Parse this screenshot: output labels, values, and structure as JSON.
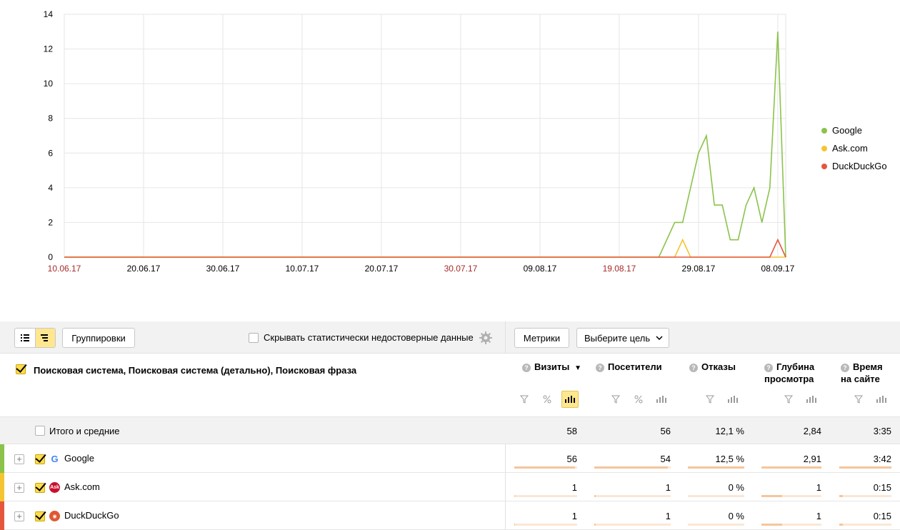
{
  "chart_data": {
    "type": "line",
    "y_ticks": [
      "0",
      "2",
      "4",
      "6",
      "8",
      "10",
      "12",
      "14"
    ],
    "ylim": [
      0,
      14
    ],
    "x_ticks": [
      {
        "label": "10.06.17",
        "weekend": true
      },
      {
        "label": "20.06.17",
        "weekend": false
      },
      {
        "label": "30.06.17",
        "weekend": false
      },
      {
        "label": "10.07.17",
        "weekend": false
      },
      {
        "label": "20.07.17",
        "weekend": false
      },
      {
        "label": "30.07.17",
        "weekend": true
      },
      {
        "label": "09.08.17",
        "weekend": false
      },
      {
        "label": "19.08.17",
        "weekend": true
      },
      {
        "label": "29.08.17",
        "weekend": false
      },
      {
        "label": "08.09.17",
        "weekend": false
      }
    ],
    "series": [
      {
        "name": "Google",
        "color": "#8bc34a",
        "points": [
          [
            "10.06.17",
            0
          ],
          [
            "24.08.17",
            0
          ],
          [
            "26.08.17",
            2
          ],
          [
            "27.08.17",
            2
          ],
          [
            "29.08.17",
            6
          ],
          [
            "30.08.17",
            7
          ],
          [
            "31.08.17",
            3
          ],
          [
            "01.09.17",
            3
          ],
          [
            "02.09.17",
            1
          ],
          [
            "03.09.17",
            1
          ],
          [
            "04.09.17",
            3
          ],
          [
            "05.09.17",
            4
          ],
          [
            "06.09.17",
            2
          ],
          [
            "07.09.17",
            4
          ],
          [
            "08.09.17",
            13
          ],
          [
            "09.09.17",
            0
          ]
        ]
      },
      {
        "name": "Ask.com",
        "color": "#f5c431",
        "points": [
          [
            "10.06.17",
            0
          ],
          [
            "26.08.17",
            0
          ],
          [
            "27.08.17",
            1
          ],
          [
            "28.08.17",
            0
          ],
          [
            "09.09.17",
            0
          ]
        ]
      },
      {
        "name": "DuckDuckGo",
        "color": "#e4573d",
        "points": [
          [
            "10.06.17",
            0
          ],
          [
            "07.09.17",
            0
          ],
          [
            "08.09.17",
            1
          ],
          [
            "09.09.17",
            0
          ]
        ]
      }
    ]
  },
  "toolbar": {
    "groupings_label": "Группировки",
    "hide_unreliable_label": "Скрывать статистически недостоверные данные",
    "metrics_label": "Метрики",
    "goal_label": "Выберите цель"
  },
  "table": {
    "dimension_header": "Поисковая система, Поисковая система (детально), Поисковая фраза",
    "columns": [
      {
        "line1": "Визиты",
        "line2": "",
        "sorted": "▼"
      },
      {
        "line1": "Посетители",
        "line2": ""
      },
      {
        "line1": "Отказы",
        "line2": ""
      },
      {
        "line1": "Глубина",
        "line2": "просмотра"
      },
      {
        "line1": "Время",
        "line2": "на сайте"
      }
    ],
    "total": {
      "label": "Итого и средние",
      "values": [
        "58",
        "56",
        "12,1 %",
        "2,84",
        "3:35"
      ]
    },
    "rows": [
      {
        "name": "Google",
        "color": "#8bc34a",
        "values": [
          "56",
          "54",
          "12,5 %",
          "2,91",
          "3:42"
        ],
        "bars": [
          0.966,
          0.964,
          1.0,
          1.0,
          1.0
        ]
      },
      {
        "name": "Ask.com",
        "color": "#f5c431",
        "values": [
          "1",
          "1",
          "0 %",
          "1",
          "0:15"
        ],
        "bars": [
          0.017,
          0.018,
          0,
          0.34,
          0.07
        ]
      },
      {
        "name": "DuckDuckGo",
        "color": "#e4573d",
        "values": [
          "1",
          "1",
          "0 %",
          "1",
          "0:15"
        ],
        "bars": [
          0.017,
          0.018,
          0,
          0.34,
          0.07
        ]
      }
    ]
  }
}
